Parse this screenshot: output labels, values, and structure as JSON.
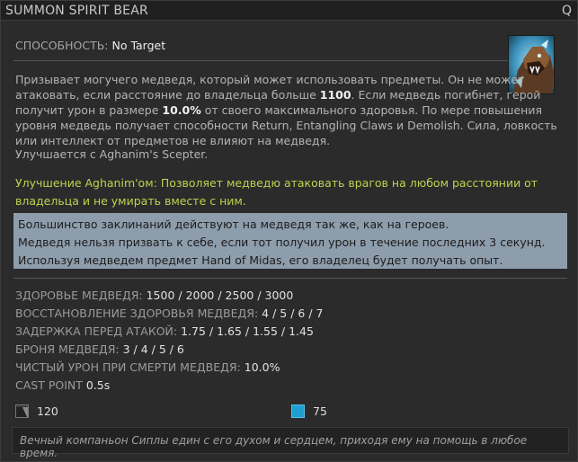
{
  "ability": {
    "title": "SUMMON SPIRIT BEAR",
    "hotkey": "Q",
    "behavior_label": "СПОСОБНОСТЬ:",
    "behavior_value": "No Target",
    "icon": "spirit-bear-portrait-icon"
  },
  "description": {
    "part1": "Призывает могучего медведя, который может использовать предметы. Он не может атаковать, если расстояние до владельца больше ",
    "range": "1100",
    "part2": ". Если медведь погибнет, герой получит урон в размере ",
    "percent": "10.0%",
    "part3": " от своего максимального здоровья. По мере повышения уровня медведь получает способности Return, Entangling Claws и Demolish. Сила, ловкость или интеллект от предметов не влияют на медведя.",
    "scepter_line": "Улучшается с Aghanim's Scepter."
  },
  "aghanim": {
    "text": "Улучшение Aghanim'ом: Позволяет медведю атаковать врагов на любом расстоянии от владельца и не умирать вместе с ним.",
    "color": "#bcd44e"
  },
  "notes": [
    "Большинство заклинаний действуют на медведя так же, как на героев.",
    "Медведя нельзя призвать к себе, если тот получил урон в течение последних 3 секунд.",
    "Используя медведем предмет Hand of Midas, его владелец будет получать опыт."
  ],
  "stats": [
    {
      "label": "ЗДОРОВЬЕ МЕДВЕДЯ:",
      "value": "1500 / 2000 / 2500 / 3000"
    },
    {
      "label": "ВОССТАНОВЛЕНИЕ ЗДОРОВЬЯ МЕДВЕДЯ:",
      "value": "4 / 5 / 6 / 7"
    },
    {
      "label": "ЗАДЕРЖКА ПЕРЕД АТАКОЙ:",
      "value": "1.75 / 1.65 / 1.55 / 1.45"
    },
    {
      "label": "БРОНЯ МЕДВЕДЯ:",
      "value": "3 / 4 / 5 / 6"
    },
    {
      "label": "ЧИСТЫЙ УРОН ПРИ СМЕРТИ МЕДВЕДЯ:",
      "value": "10.0%"
    },
    {
      "label": "CAST POINT",
      "value": "0.5s"
    }
  ],
  "costs": {
    "cooldown": "120",
    "cooldown_icon": "cooldown-icon",
    "mana": "75",
    "mana_icon": "mana-cost-icon",
    "mana_color": "#1e9fd1"
  },
  "lore": "Вечный компаньон Сиплы един с его духом и сердцем, приходя ему на помощь в любое время."
}
